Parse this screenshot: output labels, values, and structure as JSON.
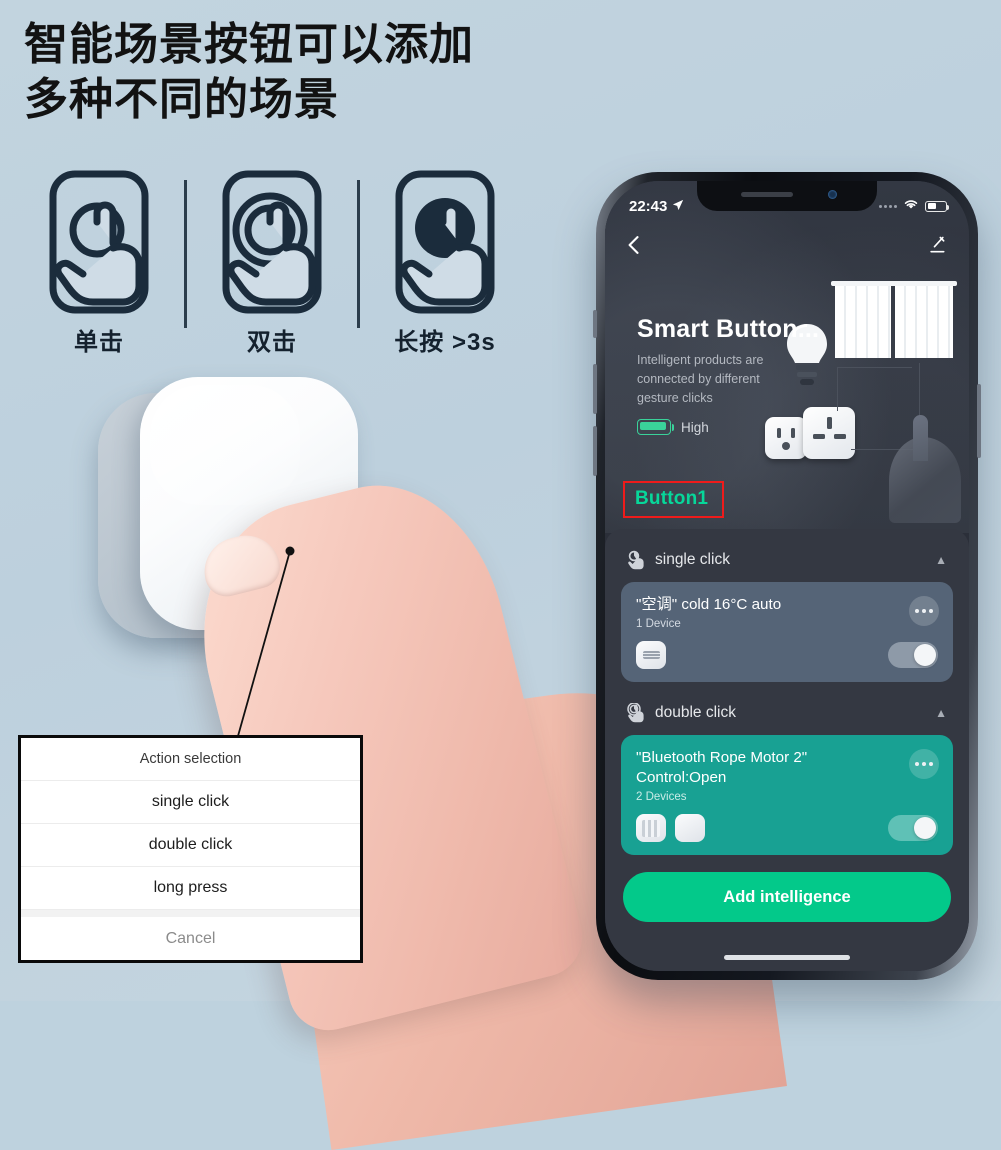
{
  "headline": {
    "line1": "智能场景按钮可以添加",
    "line2": "多种不同的场景"
  },
  "gestures": [
    {
      "label": "单击",
      "icon": "single-tap-icon"
    },
    {
      "label": "双击",
      "icon": "double-tap-icon"
    },
    {
      "label": "长按 >3s",
      "icon": "long-press-icon"
    }
  ],
  "action_sheet": {
    "title": "Action selection",
    "options": [
      "single click",
      "double click",
      "long press"
    ],
    "cancel": "Cancel"
  },
  "phone": {
    "status_bar": {
      "time": "22:43",
      "location_icon": "location-arrow-icon",
      "signal_icon": "signal-dots-icon",
      "wifi_icon": "wifi-icon",
      "battery_icon": "battery-icon"
    },
    "nav": {
      "back_icon": "back-chevron-icon",
      "edit_icon": "edit-pencil-icon"
    },
    "hero": {
      "title": "Smart Button...",
      "description": "Intelligent products are connected by different gesture clicks",
      "battery_level": "High",
      "device_name": "Button1"
    },
    "sections": [
      {
        "key": "single",
        "label": "single click",
        "icon": "single-tap-icon",
        "caret": "▲",
        "card": {
          "title": "\"空调\" cold 16°C auto",
          "subtitle": "1 Device",
          "devices": 1,
          "toggle_on": true,
          "more_icon": "more-dots-icon"
        }
      },
      {
        "key": "double",
        "label": "double click",
        "icon": "double-tap-icon",
        "caret": "▲",
        "card": {
          "title": "\"Bluetooth Rope Motor 2\"",
          "title2": "Control:Open",
          "subtitle": "2 Devices",
          "devices": 2,
          "toggle_on": true,
          "more_icon": "more-dots-icon"
        }
      }
    ],
    "cta_label": "Add intelligence"
  },
  "colors": {
    "page_bg": "#bed2de",
    "accent_green": "#03c98a",
    "device_name_green": "#07d79a",
    "highlight_red": "#ef1b1b",
    "card_single": "#556477",
    "card_double": "#18a193",
    "sheet_bg": "#343842"
  }
}
